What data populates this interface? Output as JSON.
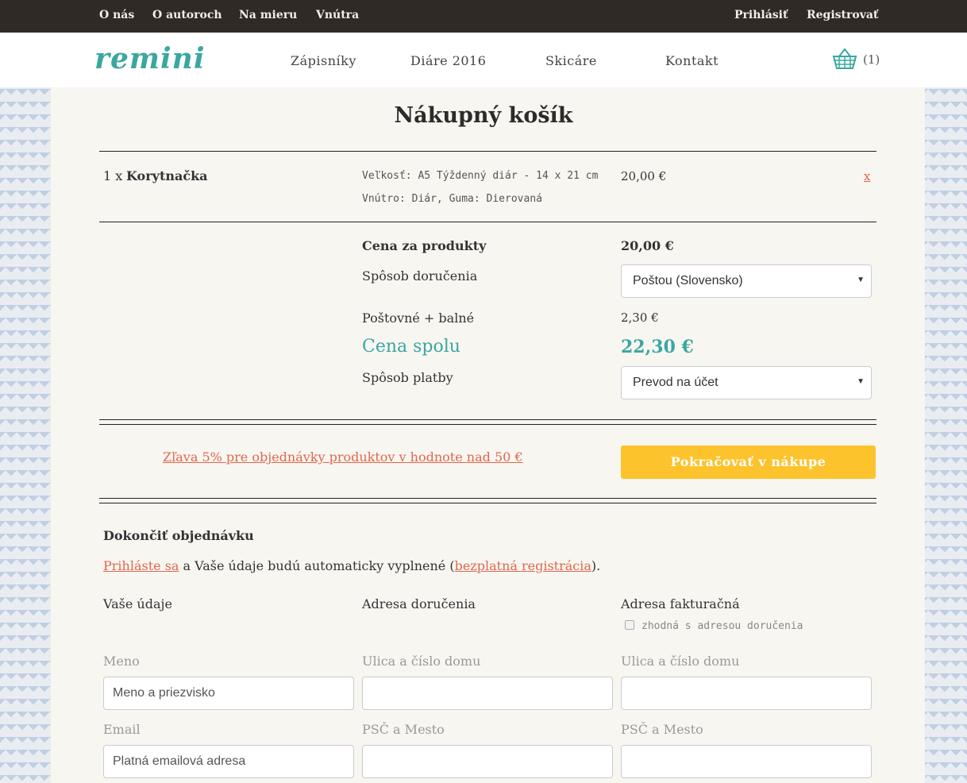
{
  "topbar": {
    "left": [
      "O nás",
      "O autoroch",
      "Na mieru",
      "Vnútra"
    ],
    "right": [
      "Prihlásiť",
      "Registrovať"
    ]
  },
  "navbar": {
    "logo": "remini",
    "links": [
      "Zápisníky",
      "Diáre 2016",
      "Skicáre",
      "Kontakt"
    ],
    "cart_count": "(1)"
  },
  "page_title": "Nákupný košík",
  "cart_item": {
    "qty": "1 x",
    "name": "Korytnačka",
    "detail1": "Veľkosť: A5 Týždenný diár - 14 x 21 cm",
    "detail2": "Vnútro: Diár, Guma: Dierovaná",
    "price": "20,00 €",
    "remove": "x"
  },
  "summary": {
    "products_label": "Cena za produkty",
    "products_value": "20,00 €",
    "delivery_label": "Spôsob doručenia",
    "delivery_value": "Poštou (Slovensko)",
    "postage_label": "Poštovné + balné",
    "postage_value": "2,30 €",
    "total_label": "Cena spolu",
    "total_value": "22,30 €",
    "payment_label": "Spôsob platby",
    "payment_value": "Prevod na účet"
  },
  "promo_link": "Zľava 5% pre objednávky produktov v hodnote nad 50 €",
  "continue_button": "Pokračovať v nákupe",
  "checkout": {
    "heading": "Dokončiť objednávku",
    "login_link": "Prihláste sa",
    "login_text_mid": "a Vaše údaje budú automaticky vyplnené (",
    "register_link": "bezplatná registrácia",
    "login_text_end": ").",
    "col1_heading": "Vaše údaje",
    "col2_heading": "Adresa doručenia",
    "col3_heading": "Adresa fakturačná",
    "same_address": "zhodná s adresou doručenia",
    "name_label": "Meno",
    "name_placeholder": "Meno a priezvisko",
    "email_label": "Email",
    "email_placeholder": "Platná emailová adresa",
    "street_label": "Ulica a číslo domu",
    "zip_label": "PSČ a Mesto"
  },
  "icons": {
    "cart": "shopping-basket-icon",
    "dropdown": "chevron-down-icon"
  },
  "colors": {
    "accent": "#3aa7a0",
    "button": "#fcc32d",
    "link": "#e0674e",
    "topbar": "#2f2a26"
  }
}
